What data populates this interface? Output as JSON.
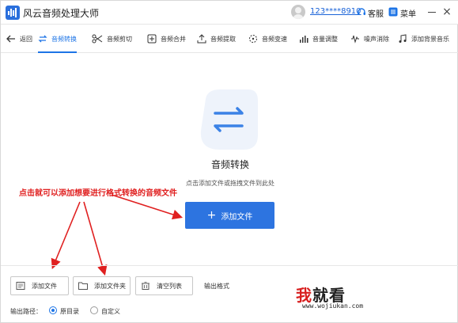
{
  "window": {
    "title": "风云音频处理大师",
    "user": "123****8910",
    "service_label": "客服",
    "menu_label": "菜单",
    "close_glyph": "×"
  },
  "toolbar": {
    "back": "返回",
    "items": [
      "音频转换",
      "音频剪切",
      "音频合并",
      "音频提取",
      "音频变速",
      "音量调整",
      "噪声消除",
      "添加背景音乐"
    ]
  },
  "main": {
    "title": "音频转换",
    "hint": "点击添加文件或拖拽文件到此处",
    "add_button": "添加文件",
    "add_button_plus": "+"
  },
  "annotation": {
    "text": "点击就可以添加想要进行格式转换的音频文件"
  },
  "bottom": {
    "add_file": "添加文件",
    "add_folder": "添加文件夹",
    "clear_list": "清空列表",
    "output_format": "输出格式",
    "output_path_label": "输出路径：",
    "option_source": "原目录",
    "option_custom": "自定义",
    "selected": "原目录"
  },
  "watermark": {
    "logo_a": "我",
    "logo_b": "就看",
    "url": "www.wojiukan.com"
  },
  "colors": {
    "accent": "#1d74e6",
    "annotation": "#e02020"
  }
}
